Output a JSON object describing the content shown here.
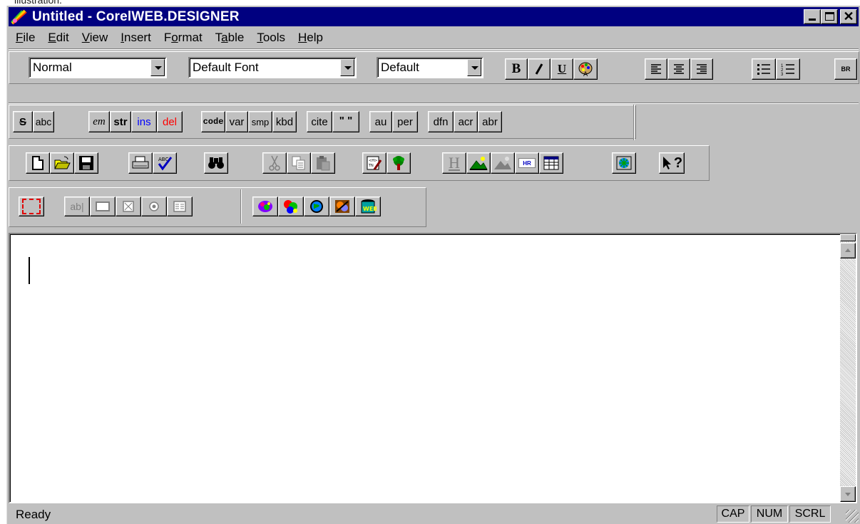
{
  "caption": "illustration.",
  "window": {
    "title": "Untitled - CorelWEB.DESIGNER"
  },
  "menu": [
    {
      "pre": "",
      "u": "F",
      "post": "ile"
    },
    {
      "pre": "",
      "u": "E",
      "post": "dit"
    },
    {
      "pre": "",
      "u": "V",
      "post": "iew"
    },
    {
      "pre": "",
      "u": "I",
      "post": "nsert"
    },
    {
      "pre": "F",
      "u": "o",
      "post": "rmat"
    },
    {
      "pre": "T",
      "u": "a",
      "post": "ble"
    },
    {
      "pre": "",
      "u": "T",
      "post": "ools"
    },
    {
      "pre": "",
      "u": "H",
      "post": "elp"
    }
  ],
  "format_bar": {
    "style_combo": "Normal",
    "font_combo": "Default Font",
    "size_combo": "Default",
    "bold": "B",
    "italic": "I",
    "underline": "U",
    "br": "BR"
  },
  "phrase_bar": {
    "strike": "S",
    "abc": "abc",
    "em": "em",
    "str": "str",
    "ins": "ins",
    "del": "del",
    "code": "code",
    "var": "var",
    "smp": "smp",
    "kbd": "kbd",
    "cite": "cite",
    "quote": "\" \"",
    "au": "au",
    "per": "per",
    "dfn": "dfn",
    "acr": "acr",
    "abr": "abr"
  },
  "standard_bar": {
    "heading": "H",
    "hr": "HR",
    "help": "?"
  },
  "form_bar": {
    "textfield": "ab|"
  },
  "editor": {
    "content": ""
  },
  "status": {
    "text": "Ready",
    "cap": "CAP",
    "num": "NUM",
    "scrl": "SCRL"
  },
  "colors": {
    "titlebar": "#000080",
    "face": "#c0c0c0",
    "ins": "#0000ff",
    "del": "#ff0000"
  }
}
